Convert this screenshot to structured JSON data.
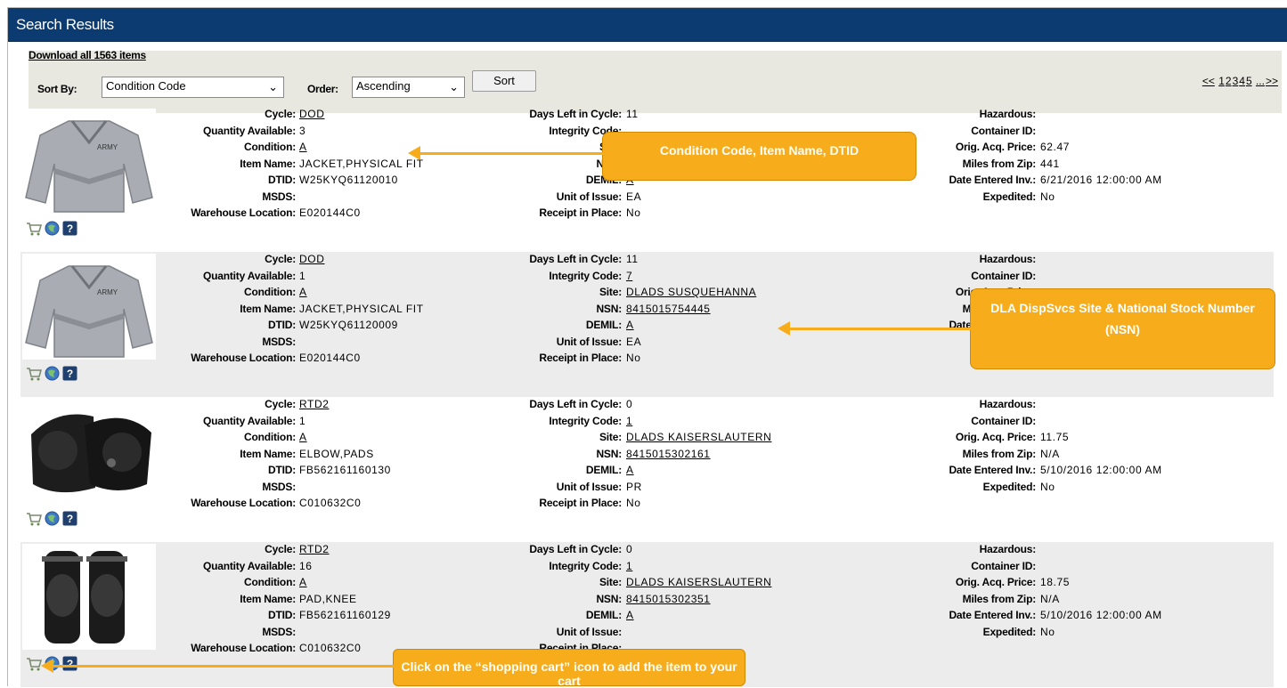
{
  "title": "Search Results",
  "download_label": "Download all 1563 items",
  "sort_by_label": "Sort By:",
  "sort_by_value": "Condition Code",
  "order_label": "Order:",
  "order_value": "Ascending",
  "sort_button": "Sort",
  "pager": [
    "<<",
    "1",
    "2",
    "3",
    "4",
    "5",
    "...",
    ">>"
  ],
  "labels": {
    "cycle": "Cycle:",
    "qty": "Quantity Available:",
    "condition": "Condition:",
    "item_name": "Item Name:",
    "dtid": "DTID:",
    "msds": "MSDS:",
    "warehouse": "Warehouse Location:",
    "days_left": "Days Left in Cycle:",
    "integrity": "Integrity Code:",
    "site": "Site:",
    "nsn": "NSN:",
    "demil": "DEMIL:",
    "unit": "Unit of Issue:",
    "receipt": "Receipt in Place:",
    "hazardous": "Hazardous:",
    "container": "Container ID:",
    "orig_price": "Orig. Acq. Price:",
    "miles": "Miles from Zip:",
    "date_entered": "Date Entered Inv.:",
    "expedited": "Expedited:"
  },
  "items": [
    {
      "cycle": "DOD",
      "qty": "3",
      "condition": "A",
      "item_name": "JACKET,PHYSICAL FIT",
      "dtid": "W25KYQ61120010",
      "msds": "",
      "warehouse": "E020144C0",
      "days_left": "11",
      "integrity": "",
      "site": "",
      "nsn": "",
      "demil": "A",
      "unit": "EA",
      "receipt": "No",
      "hazardous": "",
      "container": "",
      "orig_price": "62.47",
      "miles": "441",
      "date_entered": "6/21/2016 12:00:00 AM",
      "expedited": "No",
      "image": "jacket"
    },
    {
      "cycle": "DOD",
      "qty": "1",
      "condition": "A",
      "item_name": "JACKET,PHYSICAL FIT",
      "dtid": "W25KYQ61120009",
      "msds": "",
      "warehouse": "E020144C0",
      "days_left": "11",
      "integrity": "7",
      "site": "DLADS SUSQUEHANNA",
      "nsn": "8415015754445",
      "demil": "A",
      "unit": "EA",
      "receipt": "No",
      "hazardous": "",
      "container": "",
      "orig_price": "",
      "miles": "",
      "date_entered": "",
      "expedited": "",
      "image": "jacket"
    },
    {
      "cycle": "RTD2",
      "qty": "1",
      "condition": "A",
      "item_name": "ELBOW,PADS",
      "dtid": "FB562161160130",
      "msds": "",
      "warehouse": "C010632C0",
      "days_left": "0",
      "integrity": "1",
      "site": "DLADS KAISERSLAUTERN",
      "nsn": "8415015302161",
      "demil": "A",
      "unit": "PR",
      "receipt": "No",
      "hazardous": "",
      "container": "",
      "orig_price": "11.75",
      "miles": "N/A",
      "date_entered": "5/10/2016 12:00:00 AM",
      "expedited": "No",
      "image": "elbow"
    },
    {
      "cycle": "RTD2",
      "qty": "16",
      "condition": "A",
      "item_name": "PAD,KNEE",
      "dtid": "FB562161160129",
      "msds": "",
      "warehouse": "C010632C0",
      "days_left": "0",
      "integrity": "1",
      "site": "DLADS KAISERSLAUTERN",
      "nsn": "8415015302351",
      "demil": "A",
      "unit": "",
      "receipt": "",
      "hazardous": "",
      "container": "",
      "orig_price": "18.75",
      "miles": "N/A",
      "date_entered": "5/10/2016 12:00:00 AM",
      "expedited": "No",
      "image": "knee"
    }
  ],
  "callouts": {
    "c1": "Condition Code, Item Name, DTID",
    "c2": "DLA DispSvcs Site & National Stock Number (NSN)",
    "c3": "Click on the “shopping cart” icon to add the item to your cart"
  }
}
